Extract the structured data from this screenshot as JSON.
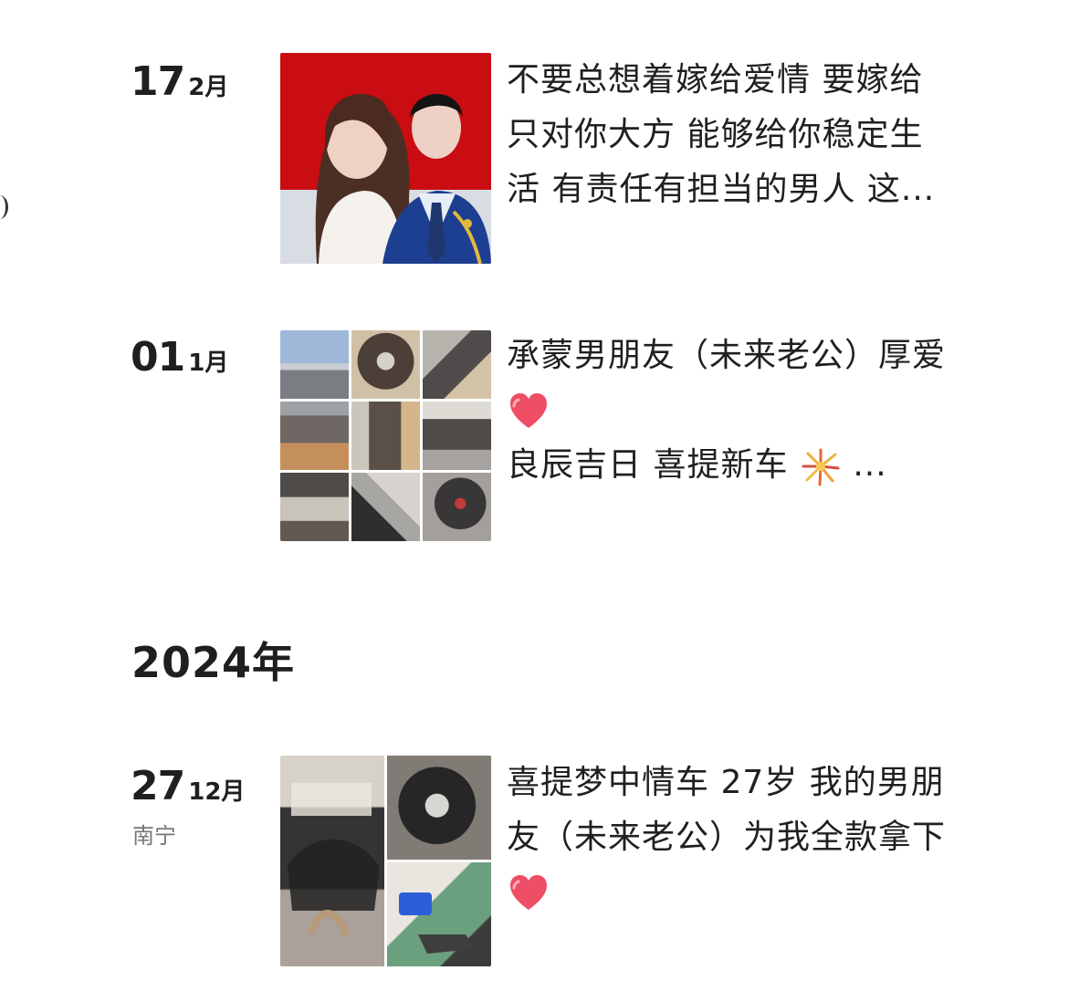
{
  "posts": [
    {
      "day": "17",
      "month": "2月",
      "caption_lines": [
        "不要总想着嫁给爱情 要嫁给",
        "只对你大方 能够给你稳定生",
        "活 有责任有担当的男人 这..."
      ],
      "image_name": "wedding-photo"
    },
    {
      "day": "01",
      "month": "1月",
      "caption_lines": [
        "承蒙男朋友（未来老公）厚爱",
        "",
        "良辰吉日 喜提新车",
        "..."
      ],
      "icons": [
        "heart-icon",
        "firework-icon"
      ],
      "image_name": "car-photo-grid"
    }
  ],
  "year_divider": "2024年",
  "post_2024": {
    "day": "27",
    "month": "12月",
    "location": "南宁",
    "caption_lines": [
      "喜提梦中情车 27岁 我的男朋",
      "友（未来老公）为我全款拿下"
    ],
    "icons": [
      "heart-icon"
    ],
    "image_name": "car-collage"
  },
  "colors": {
    "background": "#ffffff",
    "text": "#202020",
    "muted": "#777777",
    "heart": "#ee4e66",
    "wedding_red": "#c90d12"
  }
}
